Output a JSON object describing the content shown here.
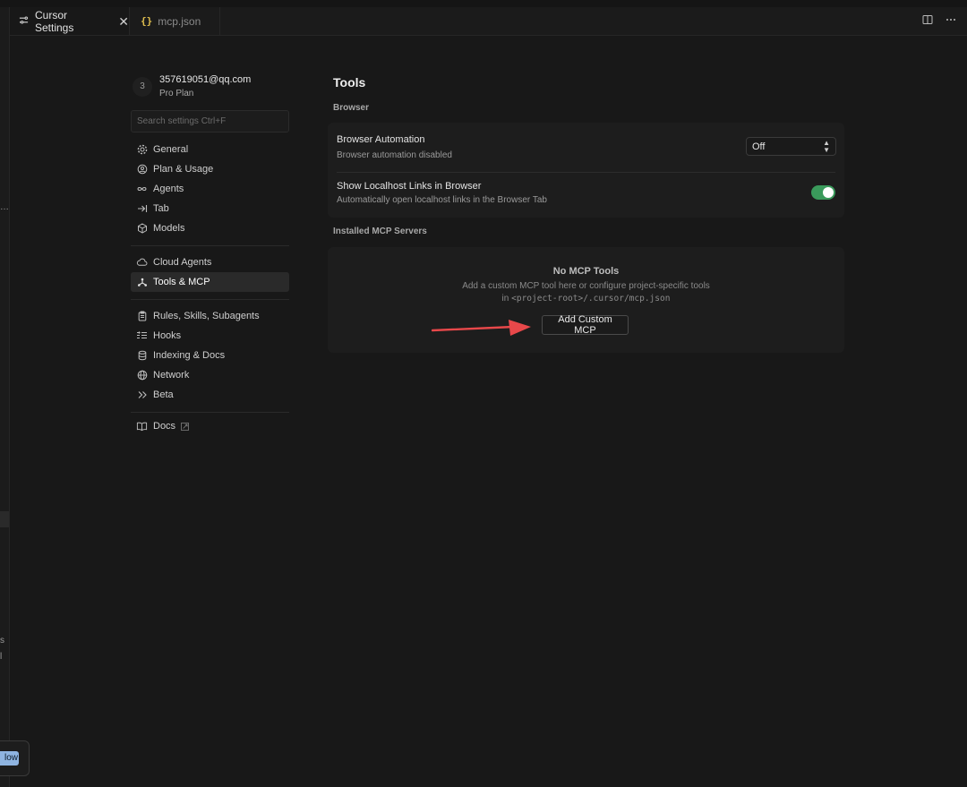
{
  "tabs": [
    {
      "title": "Cursor Settings",
      "icon": "settings-sliders-icon",
      "active": true,
      "close": "✕"
    },
    {
      "title": "mcp.json",
      "icon": "json-braces-icon",
      "icon_text": "{}",
      "active": false
    }
  ],
  "side_edge": {
    "dots": "…",
    "glyph1": "s",
    "glyph2": "l",
    "flow_button": "low"
  },
  "account": {
    "avatar": "3",
    "email": "357619051@qq.com",
    "plan": "Pro Plan"
  },
  "search": {
    "placeholder": "Search settings Ctrl+F"
  },
  "nav": {
    "group1": [
      {
        "label": "General",
        "icon": "gear-icon"
      },
      {
        "label": "Plan & Usage",
        "icon": "plan-icon"
      },
      {
        "label": "Agents",
        "icon": "infinity-icon"
      },
      {
        "label": "Tab",
        "icon": "tab-arrow-icon"
      },
      {
        "label": "Models",
        "icon": "cube-icon"
      }
    ],
    "group2": [
      {
        "label": "Cloud Agents",
        "icon": "cloud-icon"
      },
      {
        "label": "Tools & MCP",
        "icon": "tools-icon",
        "active": true
      }
    ],
    "group3": [
      {
        "label": "Rules, Skills, Subagents",
        "icon": "clipboard-icon"
      },
      {
        "label": "Hooks",
        "icon": "hooks-icon"
      },
      {
        "label": "Indexing & Docs",
        "icon": "database-icon"
      },
      {
        "label": "Network",
        "icon": "globe-icon"
      },
      {
        "label": "Beta",
        "icon": "double-chevron-icon"
      }
    ],
    "group4": [
      {
        "label": "Docs",
        "icon": "book-icon",
        "external": true
      }
    ]
  },
  "main": {
    "title": "Tools",
    "browser_section": "Browser",
    "browser_automation": {
      "title": "Browser Automation",
      "desc": "Browser automation disabled",
      "value": "Off"
    },
    "localhost_links": {
      "title": "Show Localhost Links in Browser",
      "desc": "Automatically open localhost links in the Browser Tab",
      "enabled": true
    },
    "mcp_section": "Installed MCP Servers",
    "empty": {
      "title": "No MCP Tools",
      "line1": "Add a custom MCP tool here or configure project-specific tools",
      "line2_prefix": "in",
      "path": "<project-root>/.cursor/mcp.json",
      "button": "Add Custom MCP"
    }
  },
  "colors": {
    "accent_toggle": "#3a9a5b",
    "annotation_arrow": "#e8484a",
    "background": "#181818"
  }
}
